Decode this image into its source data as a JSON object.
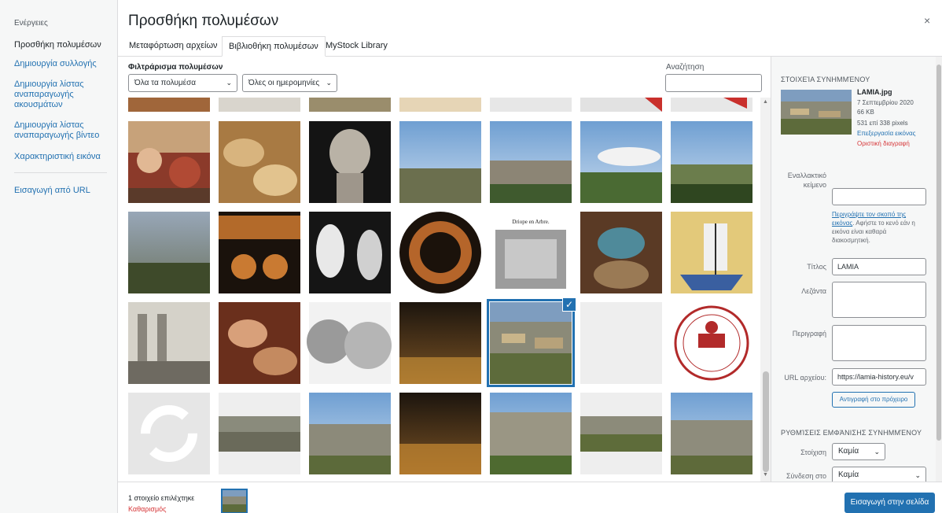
{
  "menu": {
    "heading": "Ενέργειες",
    "items": [
      "Προσθήκη πολυμέσων",
      "Δημιουργία συλλογής",
      "Δημιουργία λίστας αναπαραγωγής ακουσμάτων",
      "Δημιουργία λίστας αναπαραγωγής βίντεο",
      "Χαρακτηριστική εικόνα",
      "Εισαγωγή από URL"
    ]
  },
  "modal": {
    "title": "Προσθήκη πολυμέσων",
    "close": "×"
  },
  "tabs": [
    "Μεταφόρτωση αρχείων",
    "Βιβλιοθήκη πολυμέσων",
    "MyStock Library"
  ],
  "toolbar": {
    "filter_label": "Φιλτράρισμα πολυμέσων",
    "type_select": "Όλα τα πολυμέσα",
    "date_select": "Όλες οι ημερομηνίες",
    "search_label": "Αναζήτηση",
    "search_value": ""
  },
  "grid": {
    "selected": "LAMIA.jpg",
    "partial_label": "Driope en Arbre."
  },
  "details": {
    "heading": "Στοιχεία συνημμένου",
    "filename": "LAMIA.jpg",
    "date": "7 Σεπτεμβρίου 2020",
    "size": "66 KB",
    "dimensions": "531 επί 338 pixels",
    "edit_link": "Επεξεργασία εικόνας",
    "delete_link": "Οριστική διαγραφή",
    "alt_label": "Εναλλακτικό κείμενο",
    "alt_value": "",
    "help_link": "Περιγράψτε τον σκοπό της εικόνας",
    "help_text": ". Αφήστε το κενό εάν η εικόνα είναι καθαρά διακοσμητική.",
    "title_label": "Τίτλος",
    "title_value": "LAMIA",
    "caption_label": "Λεζάντα",
    "caption_value": "",
    "desc_label": "Περιγραφή",
    "desc_value": "",
    "url_label": "URL αρχείου:",
    "url_value": "https://lamia-history.eu/v",
    "copy_button": "Αντιγραφή στο πρόχειρο"
  },
  "display": {
    "heading": "Ρυθμίσεις εμφάνισης συνημμένου",
    "align_label": "Στοίχιση",
    "align_value": "Καμία",
    "link_label": "Σύνδεση στο",
    "link_value": "Καμία"
  },
  "footer": {
    "count": "1 στοιχείο επιλέχτηκε",
    "clear": "Καθαρισμός",
    "insert": "Εισαγωγή στην σελίδα"
  },
  "colors": {
    "accent": "#2271b1",
    "danger": "#d63638"
  }
}
